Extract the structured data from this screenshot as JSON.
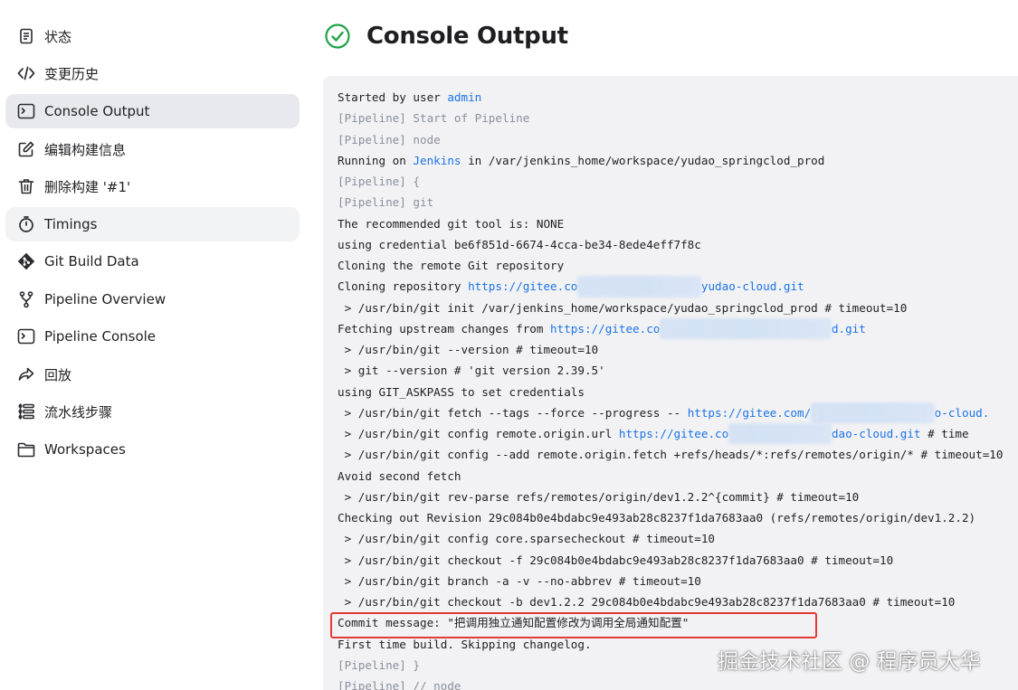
{
  "sidebar": {
    "items": [
      {
        "label": "状态",
        "icon": "document-icon"
      },
      {
        "label": "变更历史",
        "icon": "code-icon"
      },
      {
        "label": "Console Output",
        "icon": "terminal-icon"
      },
      {
        "label": "编辑构建信息",
        "icon": "edit-icon"
      },
      {
        "label": "删除构建 '#1'",
        "icon": "trash-icon"
      },
      {
        "label": "Timings",
        "icon": "clock-icon"
      },
      {
        "label": "Git Build Data",
        "icon": "git-icon"
      },
      {
        "label": "Pipeline Overview",
        "icon": "branch-icon"
      },
      {
        "label": "Pipeline Console",
        "icon": "terminal-icon"
      },
      {
        "label": "回放",
        "icon": "replay-icon"
      },
      {
        "label": "流水线步骤",
        "icon": "steps-icon"
      },
      {
        "label": "Workspaces",
        "icon": "folder-icon"
      }
    ]
  },
  "header": {
    "title": "Console Output",
    "status_icon": "success-check-icon",
    "status_color": "#1ea446"
  },
  "console": {
    "lines": [
      "Started by user admin",
      "[Pipeline] Start of Pipeline",
      "[Pipeline] node",
      "Running on Jenkins in /var/jenkins_home/workspace/yudao_springclod_prod",
      "[Pipeline] {",
      "[Pipeline] git",
      "The recommended git tool is: NONE",
      "using credential be6f851d-6674-4cca-be34-8ede4eff7f8c",
      "Cloning the remote Git repository",
      "Cloning repository https://gitee.com/...yudao-cloud.git",
      " > /usr/bin/git init /var/jenkins_home/workspace/yudao_springclod_prod # timeout=10",
      "Fetching upstream changes from https://gitee.com/...d.git",
      " > /usr/bin/git --version # timeout=10",
      " > git --version # 'git version 2.39.5'",
      "using GIT_ASKPASS to set credentials",
      " > /usr/bin/git fetch --tags --force --progress -- https://gitee.com/...o-cloud.",
      " > /usr/bin/git config remote.origin.url https://gitee.co...dao-cloud.git # time",
      " > /usr/bin/git config --add remote.origin.fetch +refs/heads/*:refs/remotes/origin/* # timeout=10",
      "Avoid second fetch",
      " > /usr/bin/git rev-parse refs/remotes/origin/dev1.2.2^{commit} # timeout=10",
      "Checking out Revision 29c084b0e4bdabc9e493ab28c8237f1da7683aa0 (refs/remotes/origin/dev1.2.2)",
      " > /usr/bin/git config core.sparsecheckout # timeout=10",
      " > /usr/bin/git checkout -f 29c084b0e4bdabc9e493ab28c8237f1da7683aa0 # timeout=10",
      " > /usr/bin/git branch -a -v --no-abbrev # timeout=10",
      " > /usr/bin/git checkout -b dev1.2.2 29c084b0e4bdabc9e493ab28c8237f1da7683aa0 # timeout=10",
      "Commit message: \"把调用独立通知配置修改为调用全局通知配置\"",
      "First time build. Skipping changelog.",
      "[Pipeline] }",
      "[Pipeline] // node"
    ]
  },
  "console_parts": {
    "l0_a": "Started by user ",
    "l0_user": "admin",
    "l1": "[Pipeline] Start of Pipeline",
    "l2": "[Pipeline] node",
    "l3_a": "Running on ",
    "l3_node": "Jenkins",
    "l3_b": " in /var/jenkins_home/workspace/yudao_springclod_prod",
    "l4": "[Pipeline] {",
    "l5": "[Pipeline] git",
    "l6": "The recommended git tool is: NONE",
    "l7": "using credential be6f851d-6674-4cca-be34-8ede4eff7f8c",
    "l8": "Cloning the remote Git repository",
    "l9_a": "Cloning repository ",
    "l9_url_a": "https://gitee.co",
    "l9_url_b": "yudao-cloud.git",
    "l10": " > /usr/bin/git init /var/jenkins_home/workspace/yudao_springclod_prod # timeout=10",
    "l11_a": "Fetching upstream changes from ",
    "l11_url_a": "https://gitee.co",
    "l11_url_b": "d.git",
    "l12": " > /usr/bin/git --version # timeout=10",
    "l13": " > git --version # 'git version 2.39.5'",
    "l14": "using GIT_ASKPASS to set credentials",
    "l15_a": " > /usr/bin/git fetch --tags --force --progress -- ",
    "l15_url_a": "https://gitee.com/",
    "l15_url_b": "o-cloud.",
    "l16_a": " > /usr/bin/git config remote.origin.url ",
    "l16_url_a": "https://gitee.co",
    "l16_url_b": "dao-cloud.git",
    "l16_b": " # time",
    "l17": " > /usr/bin/git config --add remote.origin.fetch +refs/heads/*:refs/remotes/origin/* # timeout=10",
    "l18": "Avoid second fetch",
    "l19": " > /usr/bin/git rev-parse refs/remotes/origin/dev1.2.2^{commit} # timeout=10",
    "l20": "Checking out Revision 29c084b0e4bdabc9e493ab28c8237f1da7683aa0 (refs/remotes/origin/dev1.2.2)",
    "l21": " > /usr/bin/git config core.sparsecheckout # timeout=10",
    "l22": " > /usr/bin/git checkout -f 29c084b0e4bdabc9e493ab28c8237f1da7683aa0 # timeout=10",
    "l23": " > /usr/bin/git branch -a -v --no-abbrev # timeout=10",
    "l24": " > /usr/bin/git checkout -b dev1.2.2 29c084b0e4bdabc9e493ab28c8237f1da7683aa0 # timeout=10",
    "l25": "Commit message: \"把调用独立通知配置修改为调用全局通知配置\"",
    "l26": "First time build. Skipping changelog.",
    "l27": "[Pipeline] }",
    "l28": "[Pipeline] // node"
  },
  "watermark": "掘金技术社区 @ 程序员大华",
  "colors": {
    "link": "#1a73e8",
    "pipeline_step": "#8a8f9c",
    "highlight_border": "#e53935",
    "console_bg": "#f2f2f4",
    "active_nav_bg": "#e8e9ee"
  }
}
